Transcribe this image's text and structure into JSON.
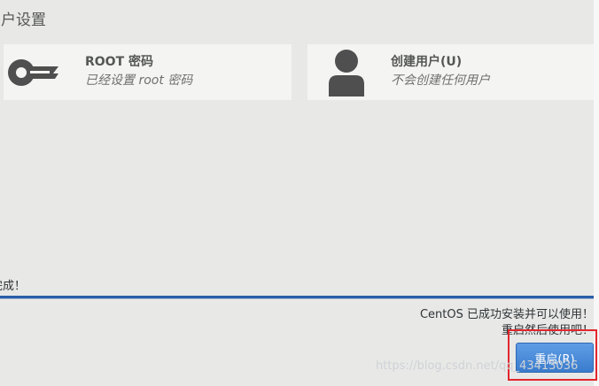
{
  "section_title": "用户设置",
  "spokes": [
    {
      "title": "ROOT 密码",
      "status": "已经设置 root 密码",
      "icon": "key-icon"
    },
    {
      "title": "创建用户(U)",
      "status": "不会创建任何用户",
      "icon": "user-icon"
    }
  ],
  "progress": {
    "label": "完成！",
    "fraction": 1.0
  },
  "messages": [
    "CentOS 已成功安装并可以使用！",
    "重启然后使用吧！"
  ],
  "reboot_label": "重启(R)",
  "watermark": "https://blog.csdn.net/qq_43413036",
  "colors": {
    "accent": "#3a7ccd",
    "highlight": "#e3262d"
  }
}
